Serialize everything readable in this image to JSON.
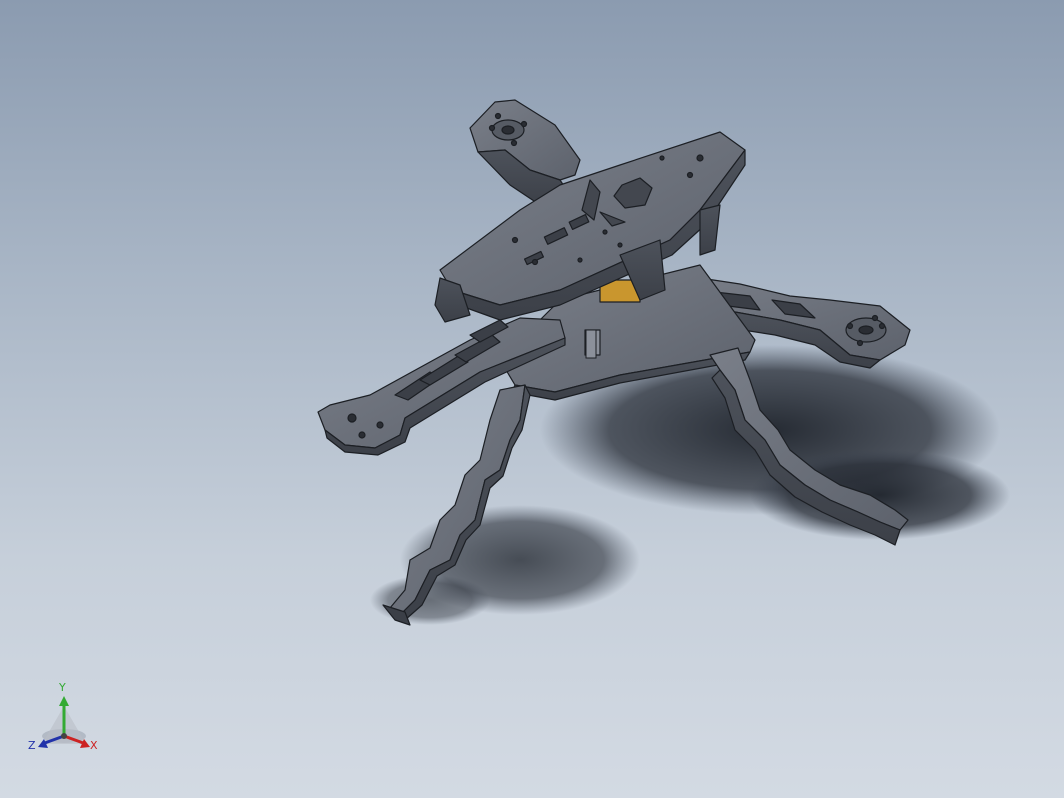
{
  "viewport": {
    "background_top": "#8b9bb0",
    "background_bottom": "#d3dae3",
    "model_color": "#6a6f79",
    "edge_color": "#1c1f24"
  },
  "triad": {
    "y_label": "Y",
    "x_label": "X",
    "z_label": "Z",
    "y_color": "#33aa33",
    "x_color": "#cc2222",
    "z_color": "#2233aa"
  }
}
